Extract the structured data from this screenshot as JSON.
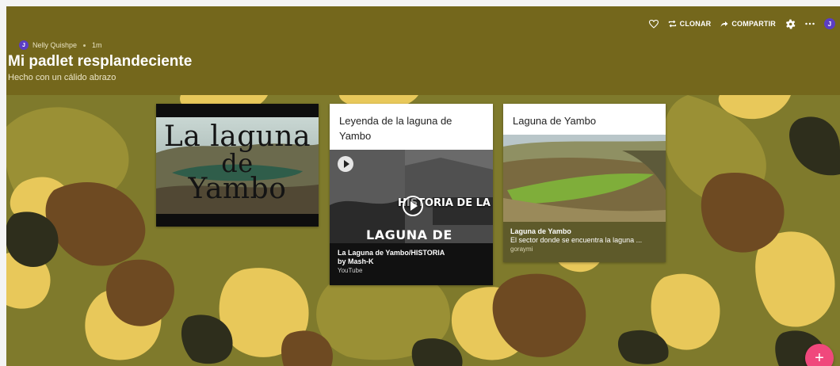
{
  "toolbar": {
    "like_icon": "heart-icon",
    "clone_label": "CLONAR",
    "share_label": "COMPARTIR",
    "settings_icon": "gear-icon",
    "more_icon": "more-icon",
    "user_initial": "J"
  },
  "header": {
    "author_initial": "J",
    "author": "Nelly Quishpe",
    "time": "1m",
    "title": "Mi padlet resplandeciente",
    "subtitle": "Hecho con un cálido abrazo"
  },
  "cards": [
    {
      "image_text_1": "La laguna",
      "image_text_2": "de",
      "image_text_3": "Yambo"
    },
    {
      "title": "Leyenda de la laguna de Yambo",
      "thumb_text_1": "HISTORIA DE LA",
      "thumb_text_2": "LAGUNA DE YAMBO",
      "link_title": "La Laguna de Yambo/HISTORIA",
      "link_by": "by Mash-K",
      "link_source": "YouTube"
    },
    {
      "title": "Laguna de Yambo",
      "link_title": "Laguna de Yambo",
      "link_desc": "El sector donde se encuentra la laguna ...",
      "link_source": "goraymi"
    }
  ],
  "fab_label": "+",
  "colors": {
    "header_bg": "#74671c",
    "accent_avatar": "#5b3dc4",
    "fab": "#f0487c"
  }
}
